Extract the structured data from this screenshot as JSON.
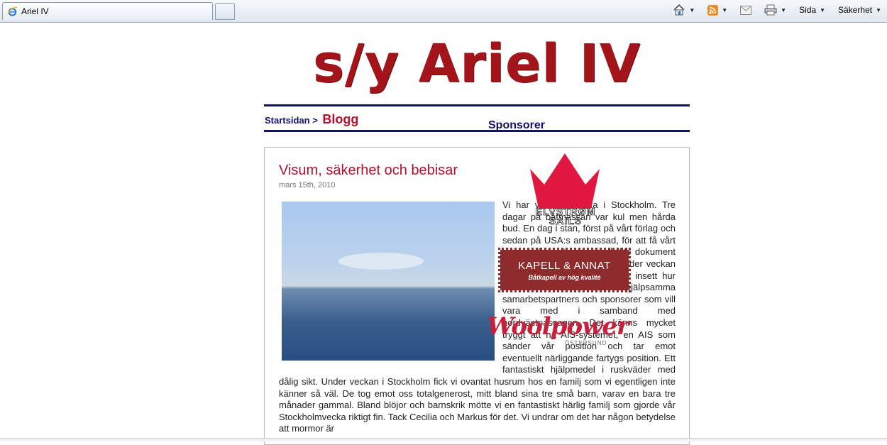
{
  "browser": {
    "tab_title": "Ariel IV",
    "commands": {
      "page_label": "Sida",
      "safety_label": "Säkerhet"
    }
  },
  "site": {
    "logo_text": "s/y Ariel IV",
    "breadcrumb": {
      "home": "Startsidan",
      "separator": ">",
      "current": "Blogg"
    },
    "sponsors_title": "Sponsorer"
  },
  "post": {
    "title": "Visum, säkerhet och bebisar",
    "date": "mars 15th, 2010",
    "body": "Vi har varit en vecka i Stockholm. Tre dagar på båtmässan var kul men hårda bud. En dag i stan, först på vårt förlag och sedan på USA:s ambassad, för att få vårt visum, efter ett samtal och lite dokument så fick vi visum för i tio år. Under veckan har vi som cruisande seglare insett hur mycket vi har av hjälpsamma samarbetspartners och sponsorer som vill vara med i samband med nordvästpassagen. Det känns mycket tryggt att ha AIS-systemet, en AIS som sänder vår position och tar emot eventuellt närliggande fartygs position. Ett fantastiskt hjälpmedel i ruskväder med dålig sikt. Under veckan i Stockholm fick vi ovantat husrum hos en familj som vi egentligen inte känner så väl. De tog emot oss totalgenerost, mitt bland sina tre små barn, varav en bara tre månader gammal. Bland blöjor och barnskrik mötte vi en fantastiskt härlig familj som gjorde vår Stockholmvecka riktigt fin. Tack Cecilia och Markus för det. Vi undrar om det har någon betydelse att mormor är"
  },
  "sponsors": {
    "elvstrom_line1": "ELVSTRØM",
    "elvstrom_line2": "SAILS",
    "kapell_name": "KAPELL & ANNAT",
    "kapell_tagline": "Båtkapell av hög kvalité",
    "woolpower_name": "Woolpower",
    "woolpower_city": "ÖSTERSUND"
  },
  "colors": {
    "accent_red": "#b0122f",
    "navy": "#11116e",
    "logo_red": "#a3151b",
    "kapell_bg": "#8e2b2d",
    "woolpower_red": "#c81f3a",
    "crown_red": "#e0173f"
  }
}
